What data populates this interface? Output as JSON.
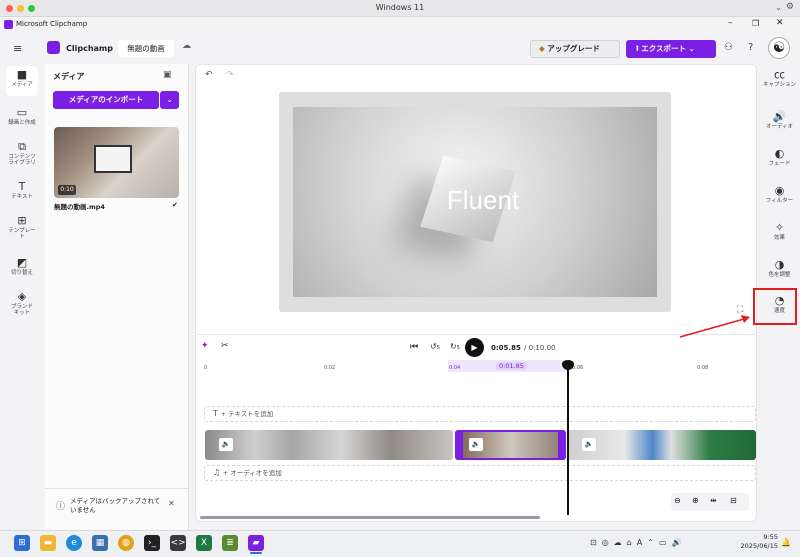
{
  "os_title": "Windows 11",
  "app": {
    "title": "Microsoft Clipchamp",
    "brand": "Clipchamp",
    "project_name": "無題の動画",
    "upgrade_label": "アップグレード",
    "export_label": "エクスポート"
  },
  "left_nav": [
    {
      "icon": "folder-icon",
      "label": "メディア"
    },
    {
      "icon": "camera-icon",
      "label": "録画と作成"
    },
    {
      "icon": "library-icon",
      "label": "コンテンツ ライブラリ"
    },
    {
      "icon": "text-icon",
      "label": "テキスト"
    },
    {
      "icon": "template-icon",
      "label": "テンプレート"
    },
    {
      "icon": "transition-icon",
      "label": "切り替え"
    },
    {
      "icon": "brand-kit-icon",
      "label": "ブランド キット"
    }
  ],
  "media": {
    "title": "メディア",
    "import_label": "メディアのインポート",
    "clip_duration": "0:10",
    "clip_name": "無題の動画.mp4",
    "backup_notice": "メディアはバックアップされていません"
  },
  "preview": {
    "overlay_text": "Fluent"
  },
  "playback": {
    "current": "0:05.85",
    "total": "/ 0:10.00",
    "skip_back": "5",
    "skip_fwd": "5"
  },
  "timeline": {
    "ticks": [
      "0",
      "0:02",
      "0:04",
      "0:06",
      "0:08"
    ],
    "selection_label": "0:01.85",
    "text_track": "+ テキストを追加",
    "audio_track": "+ オーディオを追加"
  },
  "right_nav": [
    {
      "icon": "captions-icon",
      "label": "キャプション"
    },
    {
      "icon": "audio-icon",
      "label": "オーディオ"
    },
    {
      "icon": "fade-icon",
      "label": "フェード"
    },
    {
      "icon": "filter-icon",
      "label": "フィルター"
    },
    {
      "icon": "effects-icon",
      "label": "効果"
    },
    {
      "icon": "color-adjust-icon",
      "label": "色を調整"
    },
    {
      "icon": "speed-icon",
      "label": "速度"
    }
  ],
  "taskbar": {
    "time": "9:55",
    "date": "2025/06/15"
  },
  "colors": {
    "accent": "#7b1fe4",
    "highlight": "#e02020"
  }
}
